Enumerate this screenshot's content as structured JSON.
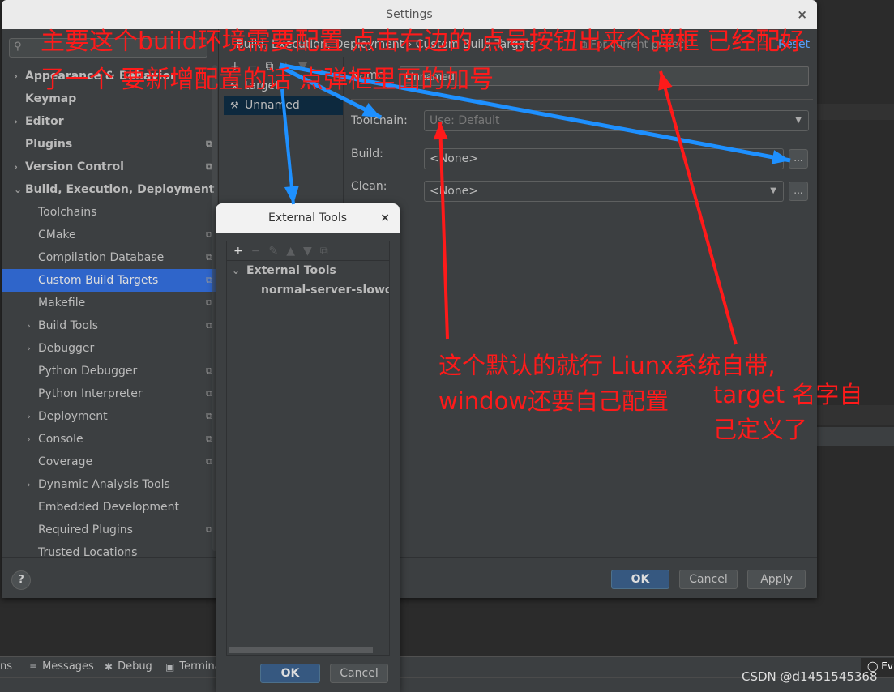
{
  "settings": {
    "title": "Settings",
    "close_icon": "×",
    "search": {
      "placeholder": "",
      "value": ""
    },
    "breadcrumb": "Build, Execution, Deployment  ›  Custom Build Targets",
    "for_current_project": "For current project",
    "reset_label": "Reset",
    "sidebar": [
      {
        "label": "Appearance & Behavior",
        "level": 0,
        "chevron": "›",
        "bold": true,
        "project": false
      },
      {
        "label": "Keymap",
        "level": 0,
        "chevron": "",
        "bold": true,
        "project": false
      },
      {
        "label": "Editor",
        "level": 0,
        "chevron": "›",
        "bold": true,
        "project": false
      },
      {
        "label": "Plugins",
        "level": 0,
        "chevron": "",
        "bold": true,
        "project": true
      },
      {
        "label": "Version Control",
        "level": 0,
        "chevron": "›",
        "bold": true,
        "project": true
      },
      {
        "label": "Build, Execution, Deployment",
        "level": 0,
        "chevron": "⌄",
        "bold": true,
        "project": false
      },
      {
        "label": "Toolchains",
        "level": 1,
        "chevron": "",
        "bold": false,
        "project": false
      },
      {
        "label": "CMake",
        "level": 1,
        "chevron": "",
        "bold": false,
        "project": true
      },
      {
        "label": "Compilation Database",
        "level": 1,
        "chevron": "",
        "bold": false,
        "project": true
      },
      {
        "label": "Custom Build Targets",
        "level": 1,
        "chevron": "",
        "bold": false,
        "project": true,
        "selected": true
      },
      {
        "label": "Makefile",
        "level": 1,
        "chevron": "",
        "bold": false,
        "project": true
      },
      {
        "label": "Build Tools",
        "level": 1,
        "chevron": "›",
        "bold": false,
        "project": true
      },
      {
        "label": "Debugger",
        "level": 1,
        "chevron": "›",
        "bold": false,
        "project": false
      },
      {
        "label": "Python Debugger",
        "level": 1,
        "chevron": "",
        "bold": false,
        "project": true
      },
      {
        "label": "Python Interpreter",
        "level": 1,
        "chevron": "",
        "bold": false,
        "project": true
      },
      {
        "label": "Deployment",
        "level": 1,
        "chevron": "›",
        "bold": false,
        "project": true
      },
      {
        "label": "Console",
        "level": 1,
        "chevron": "›",
        "bold": false,
        "project": true
      },
      {
        "label": "Coverage",
        "level": 1,
        "chevron": "",
        "bold": false,
        "project": true
      },
      {
        "label": "Dynamic Analysis Tools",
        "level": 1,
        "chevron": "›",
        "bold": false,
        "project": false
      },
      {
        "label": "Embedded Development",
        "level": 1,
        "chevron": "",
        "bold": false,
        "project": false
      },
      {
        "label": "Required Plugins",
        "level": 1,
        "chevron": "",
        "bold": false,
        "project": true
      },
      {
        "label": "Trusted Locations",
        "level": 1,
        "chevron": "",
        "bold": false,
        "project": false
      }
    ],
    "targets_toolbar": {
      "add": "+",
      "remove": "−",
      "copy": "⧉",
      "up": "▲",
      "down": "▼"
    },
    "targets": [
      {
        "label": "target",
        "icon": "⚒"
      },
      {
        "label": "Unnamed",
        "icon": "⚒",
        "selected": true
      }
    ],
    "form": {
      "name_label": "Name:",
      "name_value": "Unnamed",
      "toolchain_label": "Toolchain:",
      "toolchain_value": "Use: Default",
      "build_label": "Build:",
      "build_value": "<None>",
      "clean_label": "Clean:",
      "clean_value": "<None>",
      "dots_label": "..."
    },
    "footer": {
      "help": "?",
      "ok": "OK",
      "cancel": "Cancel",
      "apply": "Apply"
    }
  },
  "external_tools": {
    "title": "External Tools",
    "close_icon": "×",
    "toolbar": {
      "add": "+",
      "remove": "−",
      "edit": "✎",
      "up": "▲",
      "down": "▼",
      "copy": "⧉"
    },
    "group_label": "External Tools",
    "group_chevron": "⌄",
    "tool_item": "normal-server-slowdeb",
    "ok": "OK",
    "cancel": "Cancel"
  },
  "ide": {
    "tool_tabs": [
      {
        "label": "ns",
        "icon": ""
      },
      {
        "label": "Messages",
        "icon": "≡"
      },
      {
        "label": "Debug",
        "icon": "✱"
      },
      {
        "label": "Termina",
        "icon": "▣"
      }
    ],
    "event_log": "Ev",
    "watermark": "CSDN @d1451545368"
  },
  "annotations": {
    "top_line1": "主要这个build环境需要配置 点击右边的  点号按钮出来个弹框 已经配好",
    "top_line2": "了一个  要新增配置的话 点弹框里面的加号",
    "mid_line1": "这个默认的就行 Liunx系统自带,",
    "mid_line2": "window还要自己配置",
    "right_line1": "target 名字自",
    "right_line2": "己定义了",
    "arrow_blue": "#1e90ff",
    "arrow_red": "#ff1a1a"
  }
}
